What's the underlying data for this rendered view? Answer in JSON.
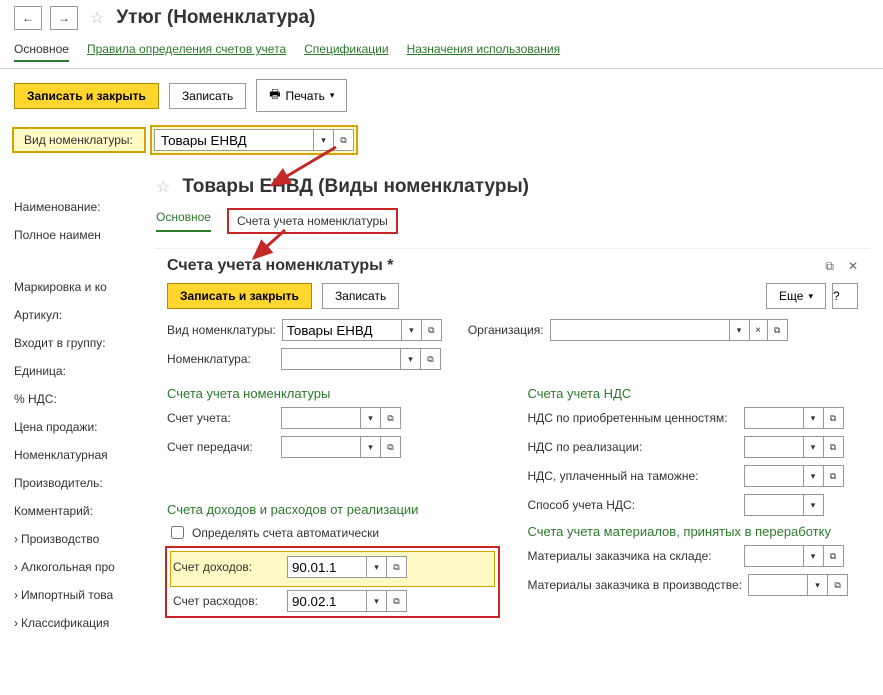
{
  "header": {
    "title": "Утюг (Номенклатура)"
  },
  "tabs": {
    "main": "Основное",
    "rules": "Правила определения счетов учета",
    "specs": "Спецификации",
    "usage": "Назначения использования"
  },
  "toolbar": {
    "save_close": "Записать и закрыть",
    "save": "Записать",
    "print": "Печать"
  },
  "form": {
    "kind_label": "Вид номенклатуры:",
    "kind_value": "Товары ЕНВД",
    "name_label": "Наименование:",
    "fullname_label": "Полное наимен",
    "mark_label": "Маркировка и ко",
    "article_label": "Артикул:",
    "group_label": "Входит в группу:",
    "unit_label": "Единица:",
    "vat_label": "% НДС:",
    "price_label": "Цена продажи:",
    "nomgroup_label": "Номенклатурная",
    "manufacturer_label": "Производитель:",
    "comment_label": "Комментарий:"
  },
  "tree": {
    "production": "Производство",
    "alcohol": "Алкогольная про",
    "import": "Импортный това",
    "classification": "Классификация"
  },
  "overlay1": {
    "title": "Товары ЕНВД (Виды номенклатуры)",
    "tab_main": "Основное",
    "tab_accounts": "Счета учета номенклатуры"
  },
  "overlay2": {
    "title": "Счета учета номенклатуры *",
    "save_close": "Записать и закрыть",
    "save": "Записать",
    "more": "Еще",
    "kind_label": "Вид номенклатуры:",
    "kind_value": "Товары ЕНВД",
    "org_label": "Организация:",
    "nom_label": "Номенклатура:",
    "sec_accounts": "Счета учета номенклатуры",
    "acc_label": "Счет учета:",
    "transfer_label": "Счет передачи:",
    "sec_vat": "Счета учета НДС",
    "vat_purchase": "НДС по приобретенным ценностям:",
    "vat_sale": "НДС по реализации:",
    "vat_customs": "НДС, уплаченный на таможне:",
    "vat_method": "Способ учета НДС:",
    "sec_income": "Счета доходов и расходов от реализации",
    "auto_check": "Определять счета автоматически",
    "income_label": "Счет доходов:",
    "income_value": "90.01.1",
    "expense_label": "Счет расходов:",
    "expense_value": "90.02.1",
    "sec_materials": "Счета учета материалов, принятых в переработку",
    "mat_stock": "Материалы заказчика на складе:",
    "mat_prod": "Материалы заказчика в производстве:"
  }
}
